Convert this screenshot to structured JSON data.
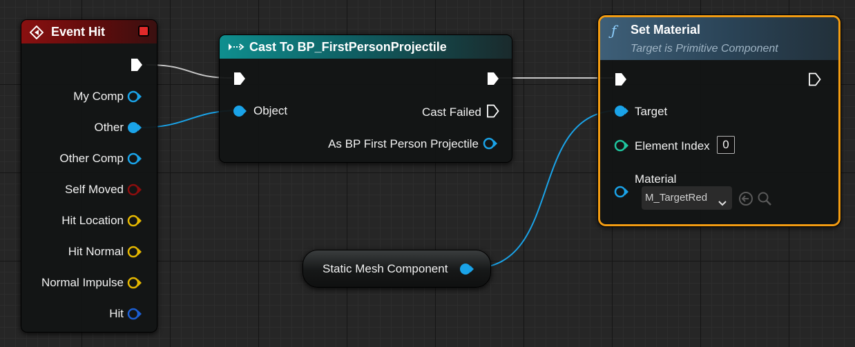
{
  "event_hit": {
    "title": "Event Hit",
    "pins": [
      {
        "label": "My Comp",
        "color": "#1aa3e8",
        "filled": false
      },
      {
        "label": "Other",
        "color": "#1aa3e8",
        "filled": true
      },
      {
        "label": "Other Comp",
        "color": "#1aa3e8",
        "filled": false
      },
      {
        "label": "Self Moved",
        "color": "#8b0e0e",
        "filled": false
      },
      {
        "label": "Hit Location",
        "color": "#e6b800",
        "filled": false
      },
      {
        "label": "Hit Normal",
        "color": "#e6b800",
        "filled": false
      },
      {
        "label": "Normal Impulse",
        "color": "#e6b800",
        "filled": false
      },
      {
        "label": "Hit",
        "color": "#1c5fd4",
        "filled": false
      }
    ]
  },
  "cast_node": {
    "title": "Cast To BP_FirstPersonProjectile",
    "object_label": "Object",
    "cast_failed_label": "Cast Failed",
    "as_label": "As BP First Person Projectile"
  },
  "set_material": {
    "title": "Set Material",
    "subtitle": "Target is Primitive Component",
    "target_label": "Target",
    "element_index_label": "Element Index",
    "element_index_value": "0",
    "material_label": "Material",
    "material_value": "M_TargetRed"
  },
  "static_mesh": {
    "label": "Static Mesh Component"
  },
  "colors": {
    "object_pin": "#1aa3e8",
    "int_pin": "#1fc7a0",
    "selection": "#f39c12",
    "exec": "#ffffff"
  }
}
